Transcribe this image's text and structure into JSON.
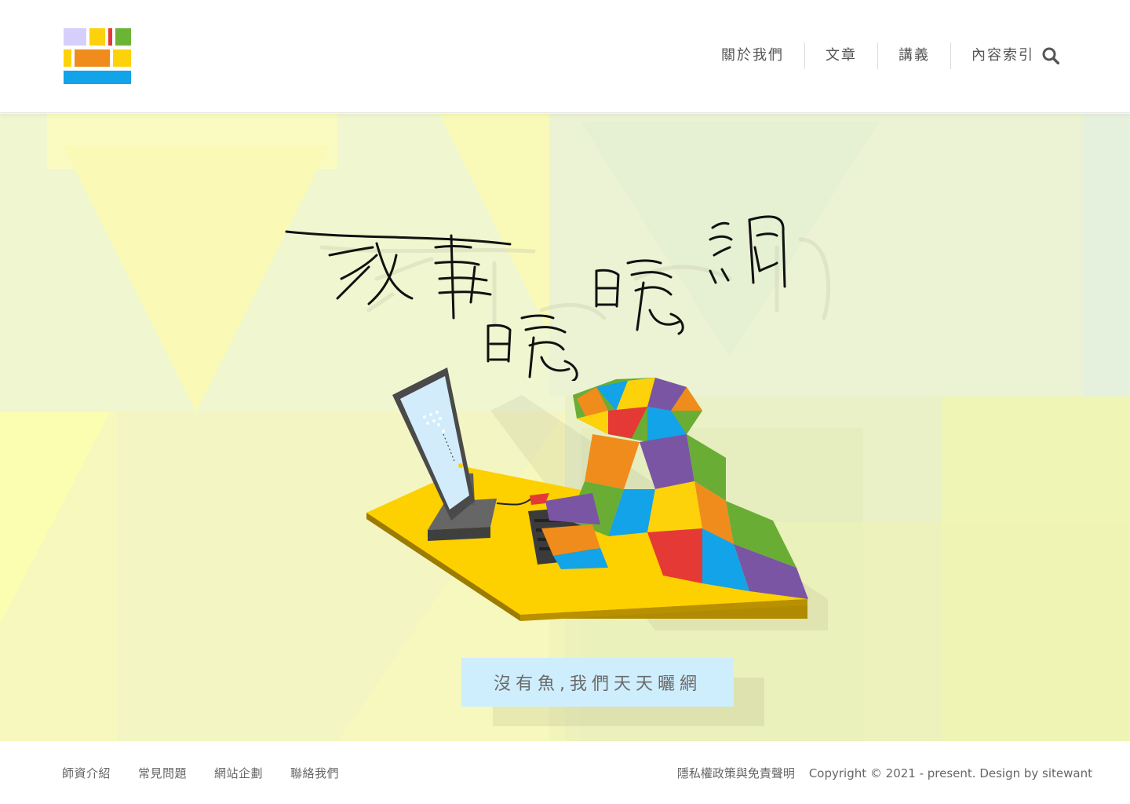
{
  "header": {
    "nav": [
      {
        "label": "關於我們"
      },
      {
        "label": "文章"
      },
      {
        "label": "講義"
      },
      {
        "label": "內容索引"
      }
    ]
  },
  "hero": {
    "tagline": "沒有魚,我們天天曬網",
    "title_art_text": "沒事曬曬網"
  },
  "footer": {
    "links": [
      {
        "label": "師資介紹"
      },
      {
        "label": "常見問題"
      },
      {
        "label": "網站企劃"
      },
      {
        "label": "聯絡我們"
      }
    ],
    "privacy": "隱私權政策與免責聲明",
    "copyright": "Copyright © 2021 - present. Design by sitewant"
  },
  "colors": {
    "logo_lavender": "#d7cffb",
    "logo_yellow": "#fdd20a",
    "logo_red": "#e53935",
    "logo_green": "#6bb536",
    "logo_orange": "#f08c1c",
    "logo_blue": "#12a3e8",
    "tagline_bg": "#cfeefd",
    "desk_yellow": "#fdd000"
  }
}
